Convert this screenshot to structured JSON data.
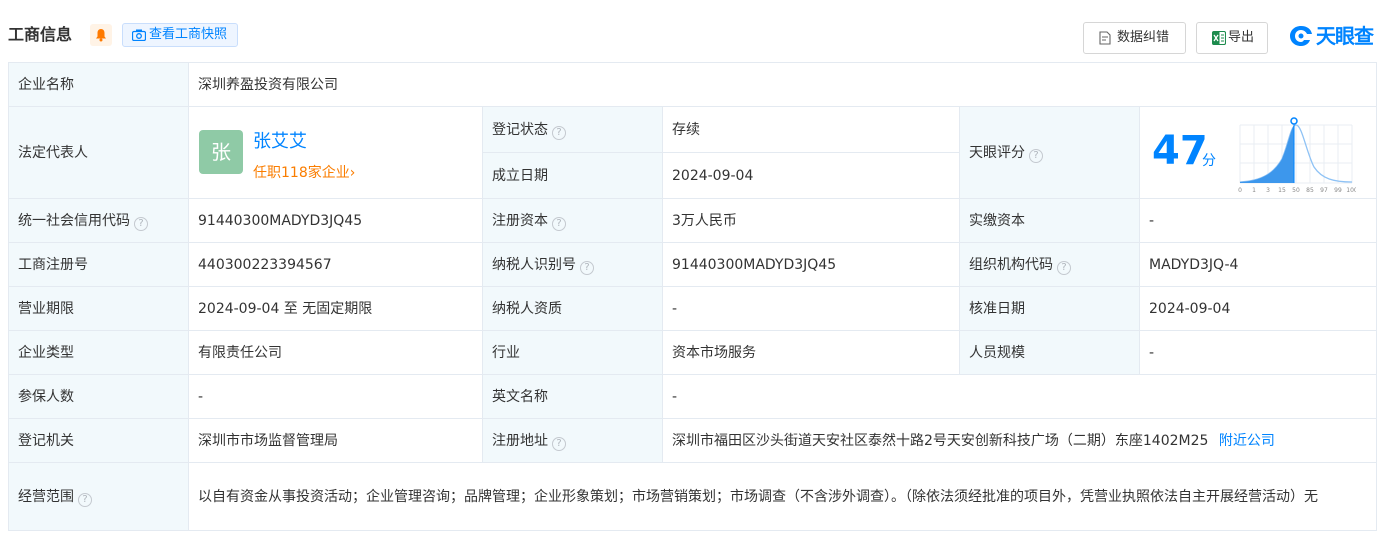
{
  "header": {
    "title": "工商信息",
    "snapshot_label": "查看工商快照",
    "correct_label": "数据纠错",
    "export_label": "导出",
    "logo_text": "天眼查"
  },
  "company": {
    "name_label": "企业名称",
    "name": "深圳养盈投资有限公司",
    "rep_label": "法定代表人",
    "rep_avatar": "张",
    "rep_name": "张艾艾",
    "rep_jobs": "任职118家企业",
    "status_label": "登记状态",
    "status": "存续",
    "found_label": "成立日期",
    "found_date": "2024-09-04",
    "score_label": "天眼评分",
    "score": "47",
    "score_unit": "分",
    "score_ticks": [
      "0",
      "1",
      "3",
      "15",
      "50",
      "85",
      "97",
      "99",
      "100"
    ],
    "credit_label": "统一社会信用代码",
    "credit_code": "91440300MADYD3JQ45",
    "capital_label": "注册资本",
    "capital": "3万人民币",
    "paid_label": "实缴资本",
    "paid": "-",
    "reg_no_label": "工商注册号",
    "reg_no": "440300223394567",
    "tax_id_label": "纳税人识别号",
    "tax_id": "91440300MADYD3JQ45",
    "org_code_label": "组织机构代码",
    "org_code": "MADYD3JQ-4",
    "term_label": "营业期限",
    "term": "2024-09-04 至 无固定期限",
    "tax_qual_label": "纳税人资质",
    "tax_qual": "-",
    "approve_label": "核准日期",
    "approve_date": "2024-09-04",
    "type_label": "企业类型",
    "type": "有限责任公司",
    "industry_label": "行业",
    "industry": "资本市场服务",
    "staff_label": "人员规模",
    "staff": "-",
    "insured_label": "参保人数",
    "insured": "-",
    "en_name_label": "英文名称",
    "en_name": "-",
    "authority_label": "登记机关",
    "authority": "深圳市市场监督管理局",
    "address_label": "注册地址",
    "address": "深圳市福田区沙头街道天安社区泰然十路2号天安创新科技广场（二期）东座1402M25",
    "nearby_label": "附近公司",
    "scope_label": "经营范围",
    "scope": "以自有资金从事投资活动；企业管理咨询；品牌管理；企业形象策划；市场营销策划；市场调查（不含涉外调查）。（除依法须经批准的项目外，凭营业执照依法自主开展经营活动）无"
  },
  "colors": {
    "accent": "#0084ff",
    "label_bg": "#f2f9fc",
    "status_green": "#009944",
    "orange": "#fa7d00"
  }
}
